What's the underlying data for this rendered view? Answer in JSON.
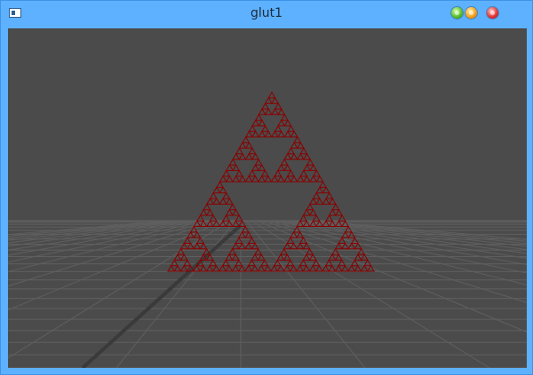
{
  "window": {
    "title": "glut1",
    "app_icon": "window-icon",
    "controls": [
      {
        "name": "minimize-button",
        "color": "#5cc12a"
      },
      {
        "name": "maximize-button",
        "color": "#f5a21a"
      },
      {
        "name": "close-button",
        "color": "#e53535"
      }
    ]
  },
  "scene": {
    "background_color": "#4b4b4b",
    "grid_color": "#5f5f5f",
    "fractal": {
      "shape": "sierpinski-triangle",
      "color": "#8b0000",
      "depth": 5
    }
  }
}
